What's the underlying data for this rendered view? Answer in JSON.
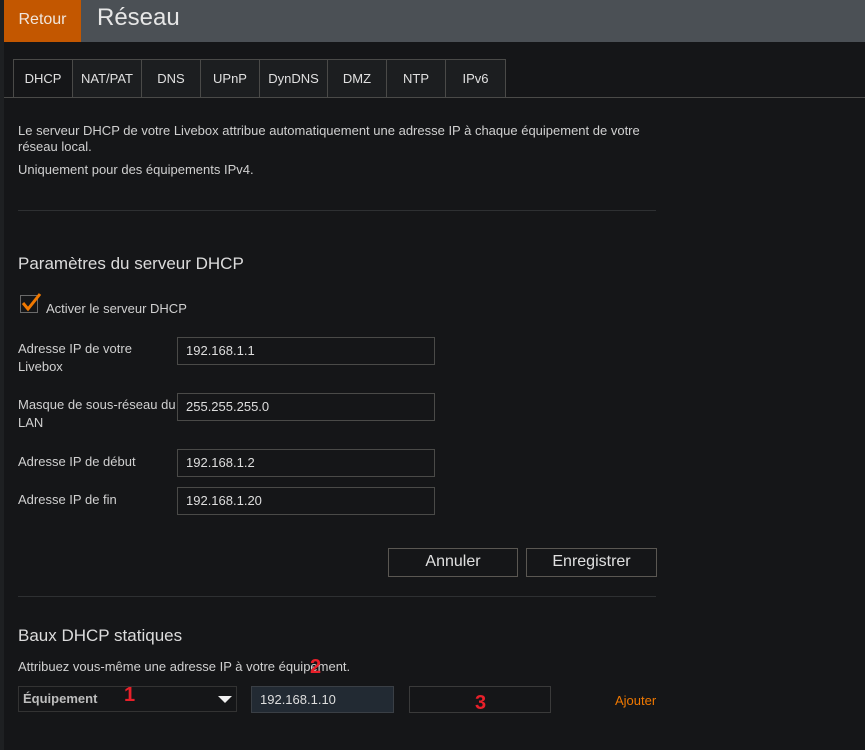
{
  "header": {
    "back_label": "Retour",
    "title": "Réseau"
  },
  "tabs": [
    {
      "label": "DHCP",
      "active": true
    },
    {
      "label": "NAT/PAT"
    },
    {
      "label": "DNS"
    },
    {
      "label": "UPnP"
    },
    {
      "label": "DynDNS"
    },
    {
      "label": "DMZ"
    },
    {
      "label": "NTP"
    },
    {
      "label": "IPv6"
    }
  ],
  "intro": {
    "line1": "Le serveur DHCP de votre Livebox attribue automatiquement une adresse IP à chaque équipement de votre réseau local.",
    "line2": "Uniquement pour des équipements IPv4."
  },
  "dhcp_settings": {
    "heading": "Paramètres du serveur DHCP",
    "enable_label": "Activer le serveur DHCP",
    "enabled": true,
    "fields": [
      {
        "label": "Adresse IP de votre Livebox",
        "value": "192.168.1.1"
      },
      {
        "label": "Masque de sous-réseau du LAN",
        "value": "255.255.255.0"
      },
      {
        "label": "Adresse IP de début",
        "value": "192.168.1.2"
      },
      {
        "label": "Adresse IP de fin",
        "value": "192.168.1.20"
      }
    ],
    "cancel_label": "Annuler",
    "save_label": "Enregistrer"
  },
  "static_leases": {
    "heading": "Baux DHCP statiques",
    "description": "Attribuez vous-même une adresse IP à votre équipement.",
    "device_select": "Équipement",
    "ip_value": "192.168.1.10",
    "extra_value": "",
    "add_label": "Ajouter"
  },
  "annotations": [
    "1",
    "2",
    "3"
  ],
  "colors": {
    "accent": "#c35700",
    "link": "#f07800",
    "annotation": "#e8202a"
  }
}
